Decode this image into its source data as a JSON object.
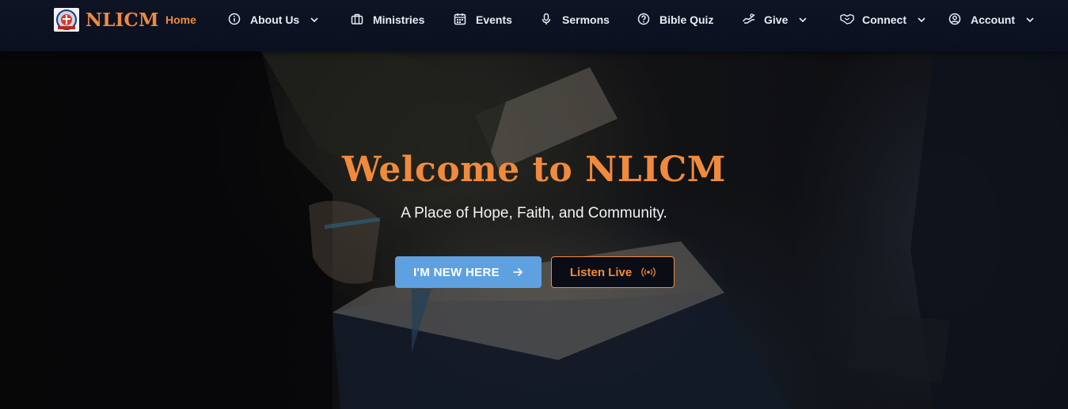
{
  "brand": {
    "name": "NLICM",
    "logo": "church-seal-logo"
  },
  "nav": {
    "items": [
      {
        "label": "Home",
        "icon": null,
        "active": true,
        "dropdown": false
      },
      {
        "label": "About Us",
        "icon": "info-icon",
        "active": false,
        "dropdown": true
      },
      {
        "label": "Ministries",
        "icon": "briefcase-icon",
        "active": false,
        "dropdown": false
      },
      {
        "label": "Events",
        "icon": "calendar-icon",
        "active": false,
        "dropdown": false
      },
      {
        "label": "Sermons",
        "icon": "microphone-icon",
        "active": false,
        "dropdown": false
      },
      {
        "label": "Bible Quiz",
        "icon": "question-icon",
        "active": false,
        "dropdown": false
      },
      {
        "label": "Give",
        "icon": "hand-coin-icon",
        "active": false,
        "dropdown": true
      },
      {
        "label": "Connect",
        "icon": "handshake-icon",
        "active": false,
        "dropdown": true
      },
      {
        "label": "Account",
        "icon": "user-circle-icon",
        "active": false,
        "dropdown": true
      }
    ]
  },
  "hero": {
    "title": "Welcome to NLICM",
    "subtitle": "A Place of Hope, Faith, and Community.",
    "primary_button": "I'M NEW HERE",
    "secondary_button": "Listen Live"
  },
  "colors": {
    "accent": "#f08a3c",
    "primary_button": "#5fa1e0",
    "navbar": "#0e1424"
  }
}
